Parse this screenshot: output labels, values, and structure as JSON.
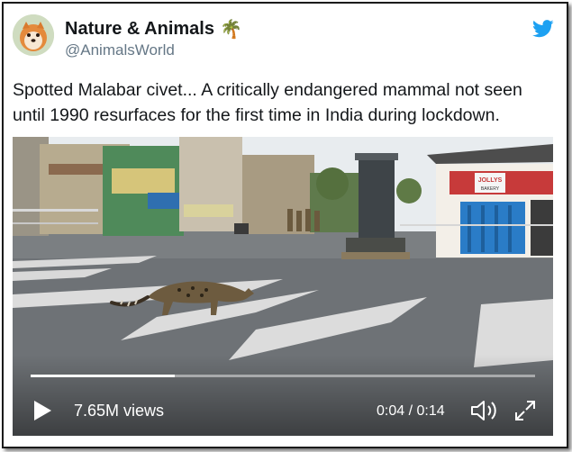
{
  "tweet": {
    "author": {
      "display_name": "Nature & Animals",
      "emoji": "🌴",
      "handle": "@AnimalsWorld",
      "avatar_icon": "dog-avatar-icon"
    },
    "text": "Spotted Malabar civet... A critically endangered mammal not seen until 1990 resurfaces for the first time in India during lockdown.",
    "platform_icon": "twitter-bird-icon"
  },
  "video": {
    "views": "7.65M views",
    "current_time": "0:04",
    "duration": "0:14",
    "timecode": "0:04 / 0:14",
    "progress_fraction": 0.286,
    "shop_signs": [
      "JOLLYS",
      "BAKERY"
    ],
    "controls": {
      "play_icon": "play-icon",
      "volume_icon": "volume-icon",
      "fullscreen_icon": "fullscreen-icon"
    }
  },
  "colors": {
    "brand_blue": "#1da1f2",
    "text": "#14171a",
    "secondary_text": "#657786"
  }
}
